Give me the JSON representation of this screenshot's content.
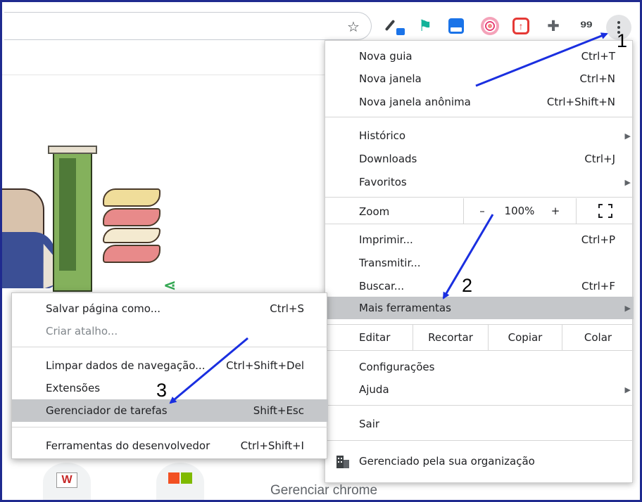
{
  "toolbar": {
    "bookmark_icon": "star-outline-icon",
    "extensions": [
      "eyedropper-extension",
      "runner-extension",
      "save-extension",
      "target-extension",
      "upload-extension",
      "puzzle-extensions-icon",
      "quote-extension"
    ],
    "menu_icon": "three-dots-menu-icon"
  },
  "chrome_menu": {
    "items_group1": [
      {
        "label": "Nova guia",
        "shortcut": "Ctrl+T"
      },
      {
        "label": "Nova janela",
        "shortcut": "Ctrl+N"
      },
      {
        "label": "Nova janela anônima",
        "shortcut": "Ctrl+Shift+N"
      }
    ],
    "items_group2": [
      {
        "label": "Histórico",
        "shortcut": ""
      },
      {
        "label": "Downloads",
        "shortcut": "Ctrl+J"
      },
      {
        "label": "Favoritos",
        "shortcut": ""
      }
    ],
    "zoom": {
      "label": "Zoom",
      "minus": "–",
      "value": "100%",
      "plus": "+"
    },
    "items_group3": [
      {
        "label": "Imprimir...",
        "shortcut": "Ctrl+P"
      },
      {
        "label": "Transmitir...",
        "shortcut": ""
      },
      {
        "label": "Buscar...",
        "shortcut": "Ctrl+F"
      },
      {
        "label": "Mais ferramentas",
        "shortcut": ""
      }
    ],
    "edit": {
      "label": "Editar",
      "cut": "Recortar",
      "copy": "Copiar",
      "paste": "Colar"
    },
    "items_group4": [
      {
        "label": "Configurações"
      },
      {
        "label": "Ajuda"
      }
    ],
    "exit": "Sair",
    "managed": "Gerenciado pela sua organização"
  },
  "more_tools_menu": {
    "items": [
      {
        "label": "Salvar página como...",
        "shortcut": "Ctrl+S"
      },
      {
        "label": "Criar atalho...",
        "shortcut": ""
      },
      {
        "label": "Limpar dados de navegação...",
        "shortcut": "Ctrl+Shift+Del"
      },
      {
        "label": "Extensões",
        "shortcut": ""
      },
      {
        "label": "Gerenciador de tarefas",
        "shortcut": "Shift+Esc"
      },
      {
        "label": "Ferramentas do desenvolvedor",
        "shortcut": "Ctrl+Shift+I"
      }
    ]
  },
  "annotations": {
    "step1": "1",
    "step2": "2",
    "step3": "3",
    "arrow_color": "#1a2fe0",
    "caption": "Gerenciar chrome"
  },
  "page": {
    "tile_w_letter": "W"
  }
}
